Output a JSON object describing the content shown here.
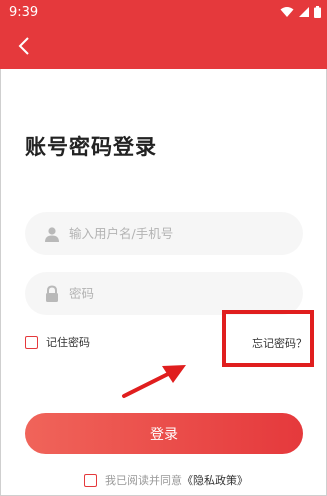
{
  "status": {
    "time": "9:39"
  },
  "header": {
    "back_icon": "chevron-left-icon"
  },
  "title": "账号密码登录",
  "username": {
    "placeholder": "输入用户名/手机号",
    "icon": "user-icon"
  },
  "password": {
    "placeholder": "密码",
    "icon": "lock-icon"
  },
  "remember": {
    "label": "记住密码"
  },
  "forgot": {
    "label": "忘记密码？"
  },
  "login": {
    "label": "登录"
  },
  "agreement": {
    "text": "我已阅读并同意",
    "link": "《隐私政策》"
  },
  "colors": {
    "brand": "#e5393c",
    "annotation": "#e01e1e"
  }
}
